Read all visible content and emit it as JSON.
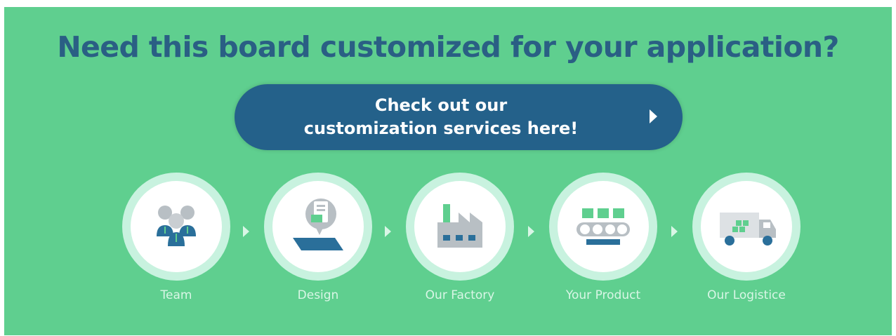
{
  "headline": "Need this board customized for your application?",
  "cta": {
    "line1": "Check out our",
    "line2": "customization services here!",
    "icon": "chevron-right-icon"
  },
  "steps": [
    {
      "label": "Team",
      "icon": "team-icon"
    },
    {
      "label": "Design",
      "icon": "design-icon"
    },
    {
      "label": "Our Factory",
      "icon": "factory-icon"
    },
    {
      "label": "Your Product",
      "icon": "product-icon"
    },
    {
      "label": "Our Logistice",
      "icon": "truck-icon"
    }
  ],
  "colors": {
    "background": "#5fcf8f",
    "headline": "#2a5f84",
    "button": "#24618a",
    "ring": "#c8f2df",
    "label": "#d9f6e6"
  }
}
